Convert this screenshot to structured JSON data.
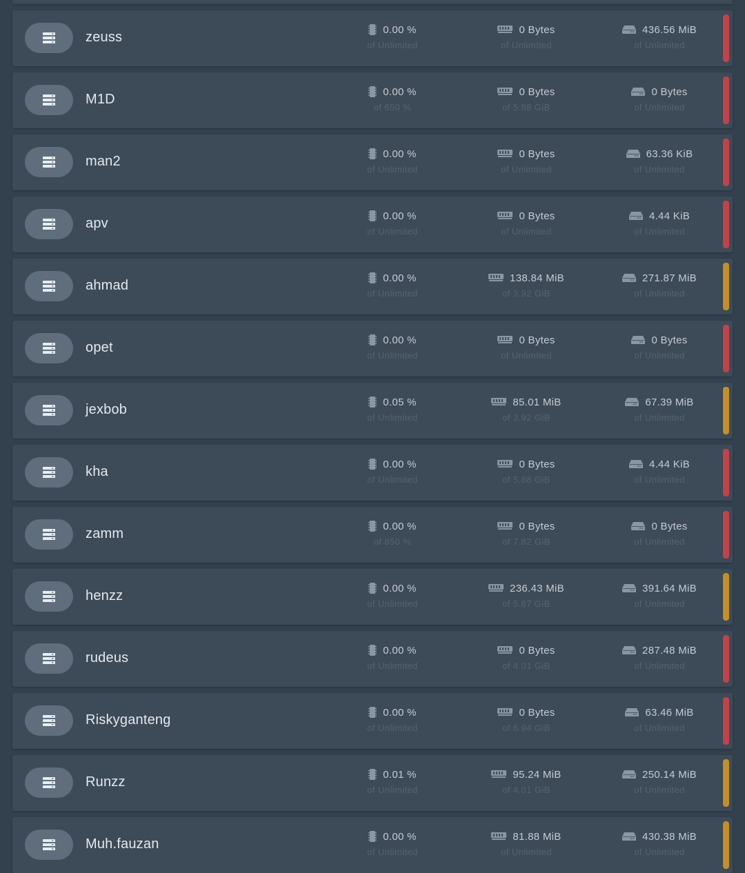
{
  "colors": {
    "status_offline": "#c0434b",
    "status_starting": "#c38f2d"
  },
  "icons": {
    "server": "server-stack-icon",
    "cpu": "cpu-chip-icon",
    "memory": "memory-module-icon",
    "disk": "hard-drive-icon"
  },
  "servers": [
    {
      "name": "",
      "cpu": "",
      "cpu_limit": "",
      "memory": "",
      "memory_limit": "",
      "disk": "",
      "disk_limit": "",
      "status": "offline"
    },
    {
      "name": "zeuss",
      "cpu": "0.00 %",
      "cpu_limit": "of Unlimited",
      "memory": "0 Bytes",
      "memory_limit": "of Unlimited",
      "disk": "436.56 MiB",
      "disk_limit": "of Unlimited",
      "status": "offline"
    },
    {
      "name": "M1D",
      "cpu": "0.00 %",
      "cpu_limit": "of 650 %",
      "memory": "0 Bytes",
      "memory_limit": "of 5.88 GiB",
      "disk": "0 Bytes",
      "disk_limit": "of Unlimited",
      "status": "offline"
    },
    {
      "name": "man2",
      "cpu": "0.00 %",
      "cpu_limit": "of Unlimited",
      "memory": "0 Bytes",
      "memory_limit": "of Unlimited",
      "disk": "63.36 KiB",
      "disk_limit": "of Unlimited",
      "status": "offline"
    },
    {
      "name": "apv",
      "cpu": "0.00 %",
      "cpu_limit": "of Unlimited",
      "memory": "0 Bytes",
      "memory_limit": "of Unlimited",
      "disk": "4.44 KiB",
      "disk_limit": "of Unlimited",
      "status": "offline"
    },
    {
      "name": "ahmad",
      "cpu": "0.00 %",
      "cpu_limit": "of Unlimited",
      "memory": "138.84 MiB",
      "memory_limit": "of 3.92 GiB",
      "disk": "271.87 MiB",
      "disk_limit": "of Unlimited",
      "status": "starting"
    },
    {
      "name": "opet",
      "cpu": "0.00 %",
      "cpu_limit": "of Unlimited",
      "memory": "0 Bytes",
      "memory_limit": "of Unlimited",
      "disk": "0 Bytes",
      "disk_limit": "of Unlimited",
      "status": "offline"
    },
    {
      "name": "jexbob",
      "cpu": "0.05 %",
      "cpu_limit": "of Unlimited",
      "memory": "85.01 MiB",
      "memory_limit": "of 3.92 GiB",
      "disk": "67.39 MiB",
      "disk_limit": "of Unlimited",
      "status": "starting"
    },
    {
      "name": "kha",
      "cpu": "0.00 %",
      "cpu_limit": "of Unlimited",
      "memory": "0 Bytes",
      "memory_limit": "of 5.88 GiB",
      "disk": "4.44 KiB",
      "disk_limit": "of Unlimited",
      "status": "offline"
    },
    {
      "name": "zamm",
      "cpu": "0.00 %",
      "cpu_limit": "of 850 %",
      "memory": "0 Bytes",
      "memory_limit": "of 7.82 GiB",
      "disk": "0 Bytes",
      "disk_limit": "of Unlimited",
      "status": "offline"
    },
    {
      "name": "henzz",
      "cpu": "0.00 %",
      "cpu_limit": "of Unlimited",
      "memory": "236.43 MiB",
      "memory_limit": "of 5.87 GiB",
      "disk": "391.64 MiB",
      "disk_limit": "of Unlimited",
      "status": "starting"
    },
    {
      "name": "rudeus",
      "cpu": "0.00 %",
      "cpu_limit": "of Unlimited",
      "memory": "0 Bytes",
      "memory_limit": "of 4.01 GiB",
      "disk": "287.48 MiB",
      "disk_limit": "of Unlimited",
      "status": "offline"
    },
    {
      "name": "Riskyganteng",
      "cpu": "0.00 %",
      "cpu_limit": "of Unlimited",
      "memory": "0 Bytes",
      "memory_limit": "of 6.94 GiB",
      "disk": "63.46 MiB",
      "disk_limit": "of Unlimited",
      "status": "offline"
    },
    {
      "name": "Runzz",
      "cpu": "0.01 %",
      "cpu_limit": "of Unlimited",
      "memory": "95.24 MiB",
      "memory_limit": "of 4.01 GiB",
      "disk": "250.14 MiB",
      "disk_limit": "of Unlimited",
      "status": "starting"
    },
    {
      "name": "Muh.fauzan",
      "cpu": "0.00 %",
      "cpu_limit": "of Unlimited",
      "memory": "81.88 MiB",
      "memory_limit": "of Unlimited",
      "disk": "430.38 MiB",
      "disk_limit": "of Unlimited",
      "status": "starting"
    }
  ]
}
